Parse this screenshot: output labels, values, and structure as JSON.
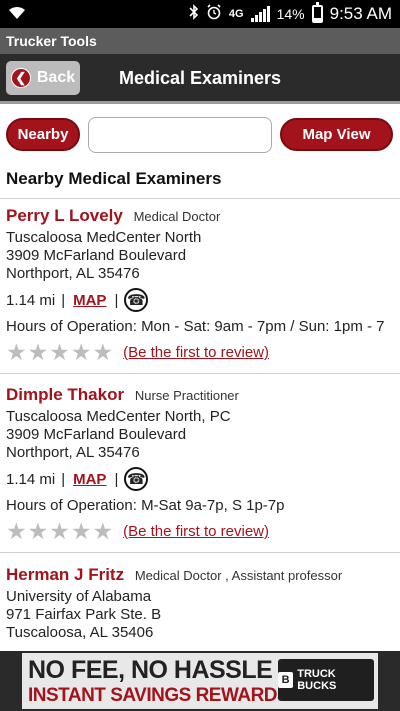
{
  "status_bar": {
    "time": "9:53 AM",
    "battery": "14%",
    "network": "4G",
    "icons": [
      "wifi-icon",
      "bluetooth-icon",
      "alarm-icon",
      "lte-icon",
      "signal-icon",
      "battery-icon"
    ]
  },
  "app": {
    "title": "Trucker Tools"
  },
  "nav": {
    "back_label": "Back",
    "title": "Medical Examiners"
  },
  "controls": {
    "nearby_label": "Nearby",
    "search_value": "",
    "map_view_label": "Map View"
  },
  "section_heading": "Nearby Medical Examiners",
  "examiners": [
    {
      "name": "Perry L Lovely",
      "type": "Medical Doctor",
      "facility": "Tuscaloosa MedCenter North",
      "street": "3909 McFarland Boulevard",
      "city": "Northport, AL 35476",
      "distance": "1.14 mi",
      "map_label": "MAP",
      "hours": "Hours of Operation: Mon - Sat: 9am - 7pm / Sun: 1pm - 7",
      "review_link": "(Be the first to review)",
      "rating": 0
    },
    {
      "name": "Dimple Thakor",
      "type": "Nurse Practitioner",
      "facility": "Tuscaloosa MedCenter North, PC",
      "street": "3909 McFarland Boulevard",
      "city": "Northport, AL 35476",
      "distance": "1.14 mi",
      "map_label": "MAP",
      "hours": "Hours of Operation: M-Sat 9a-7p, S 1p-7p",
      "review_link": "(Be the first to review)",
      "rating": 0
    },
    {
      "name": "Herman J Fritz",
      "type": "Medical Doctor , Assistant professor",
      "facility": "University of Alabama",
      "street": "971 Fairfax Park Ste. B",
      "city": "Tuscaloosa, AL 35406"
    }
  ],
  "ad": {
    "line1": "NO FEE, NO HASSLE",
    "line2": "INSTANT SAVINGS REWARDS CARD",
    "card_label": "TRUCK BUCKS"
  },
  "colors": {
    "accent": "#a3131b",
    "nav_bg": "#2b2b2b",
    "title_bar": "#5c5c5c"
  }
}
